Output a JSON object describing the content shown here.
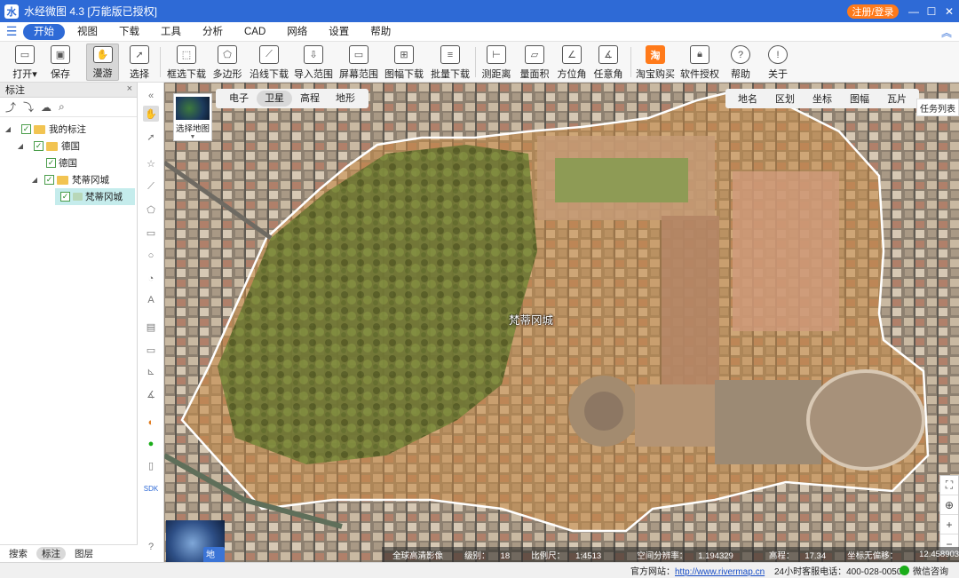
{
  "titlebar": {
    "title": "水经微图 4.3 [万能版已授权]",
    "login_button": "注册/登录",
    "accent_color": "#2e6ad6",
    "login_color": "#ff7a1a"
  },
  "menubar": {
    "items": [
      "开始",
      "视图",
      "下载",
      "工具",
      "分析",
      "CAD",
      "网络",
      "设置",
      "帮助"
    ],
    "active": "开始"
  },
  "toolbar": {
    "items": [
      {
        "label": "打开",
        "icon": "folder-icon",
        "caret": "▾"
      },
      {
        "label": "保存",
        "icon": "save-icon"
      },
      {
        "label": "漫游",
        "icon": "hand-icon"
      },
      {
        "label": "选择",
        "icon": "cursor-icon"
      },
      {
        "label": "框选下载",
        "icon": "rect-download-icon"
      },
      {
        "label": "多边形",
        "icon": "polygon-download-icon"
      },
      {
        "label": "沿线下载",
        "icon": "line-download-icon"
      },
      {
        "label": "导入范围",
        "icon": "import-range-icon"
      },
      {
        "label": "屏幕范围",
        "icon": "screen-range-icon"
      },
      {
        "label": "图幅下载",
        "icon": "grid-download-icon"
      },
      {
        "label": "批量下载",
        "icon": "batch-download-icon"
      },
      {
        "label": "测距离",
        "icon": "ruler-icon"
      },
      {
        "label": "量面积",
        "icon": "area-icon"
      },
      {
        "label": "方位角",
        "icon": "azimuth-icon"
      },
      {
        "label": "任意角",
        "icon": "angle-icon"
      },
      {
        "label": "淘宝购买",
        "icon": "taobao-icon",
        "glyph": "淘"
      },
      {
        "label": "软件授权",
        "icon": "lock-icon"
      },
      {
        "label": "帮助",
        "icon": "help-icon",
        "glyph": "?"
      },
      {
        "label": "关于",
        "icon": "info-icon",
        "glyph": "!"
      }
    ]
  },
  "left_panel": {
    "header": "标注",
    "close": "×",
    "tree": [
      {
        "label": "我的标注",
        "level": 0,
        "type": "folder",
        "checked": true
      },
      {
        "label": "德国",
        "level": 1,
        "type": "folder",
        "checked": true
      },
      {
        "label": "德国",
        "level": 2,
        "type": "item",
        "checked": true
      },
      {
        "label": "梵蒂冈城",
        "level": 1,
        "type": "folder",
        "checked": true
      },
      {
        "label": "梵蒂冈城",
        "level": 2,
        "type": "polygon",
        "checked": true,
        "selected": true
      }
    ],
    "bottom_tabs": [
      "搜索",
      "标注",
      "图层"
    ],
    "active_bottom_tab": "标注"
  },
  "map": {
    "type_switch_label": "选择地图",
    "source_tabs": [
      "电子",
      "卫星",
      "高程",
      "地形"
    ],
    "active_source": "卫星",
    "right_tabs": [
      "地名",
      "区划",
      "坐标",
      "图幅",
      "瓦片"
    ],
    "task_list": "任务列表",
    "place_label": "梵蒂冈城",
    "globe_label": "地球",
    "zoom_controls": [
      "⛶",
      "⊕",
      "+",
      "−"
    ],
    "status": {
      "imagery": "全球高清影像",
      "level_label": "级别：",
      "level": "18",
      "scale_label": "比例尺：",
      "scale": "1:4513",
      "resolution_label": "空间分辨率：",
      "resolution": "1.194329",
      "elevation_label": "高程：",
      "elevation": "17.34",
      "coord_label": "坐标无偏移：",
      "coords": "12.45890379, 41.90469861"
    }
  },
  "statusbar": {
    "website_label": "官方网站：",
    "website": "http://www.rivermap.cn",
    "hotline": "24小时客服电话：400-028-0050",
    "wechat": "微信咨询"
  }
}
